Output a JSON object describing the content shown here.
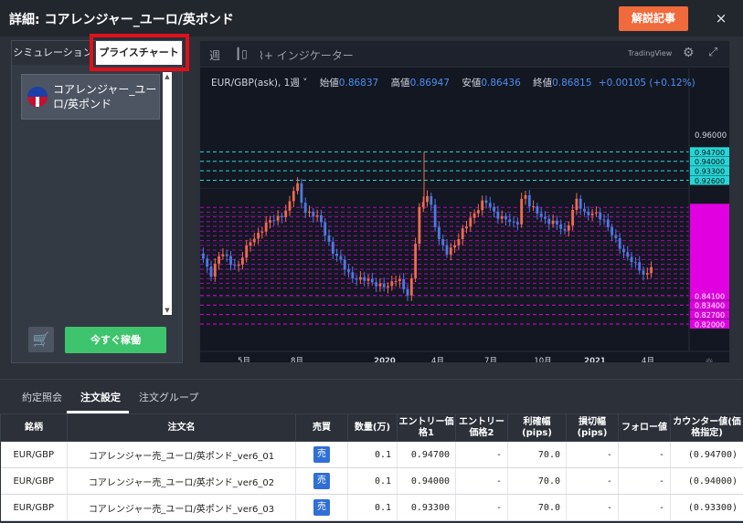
{
  "header": {
    "title": "詳細: コアレンジャー_ユーロ/英ポンド",
    "guide_button": "解説記事",
    "close": "×"
  },
  "left_panel": {
    "tabs": [
      "シミュレーション",
      "プライスチャート"
    ],
    "selected_item": "コアレンジャー_ユーロ/英ポンド",
    "run_button": "今すぐ稼働"
  },
  "chart": {
    "toolbar": {
      "period": "週",
      "indicator": "インジケーター",
      "brand": "TradingView"
    },
    "symbol": "EUR/GBP(ask), 1週",
    "ohlc": {
      "open_label": "始値",
      "open": "0.86837",
      "high_label": "高値",
      "high": "0.86947",
      "low_label": "安値",
      "low": "0.86436",
      "close_label": "終値",
      "close": "0.86815",
      "change": "+0.00105 (+0.12%)"
    },
    "price_top_label": "0.96000",
    "cyan_levels": [
      "0.94700",
      "0.94000",
      "0.93300",
      "0.92600"
    ],
    "magenta_levels": [
      "0.84100",
      "0.83400",
      "0.82700",
      "0.82000"
    ],
    "x_labels": [
      "5月",
      "8月",
      "2020",
      "4月",
      "7月",
      "10月",
      "2021",
      "4月"
    ],
    "colors": {
      "up": "#ef6b4f",
      "down": "#4a7be0",
      "cyan": "#26d6d6",
      "magenta": "#e000e0"
    }
  },
  "bottom": {
    "tabs": [
      "約定照会",
      "注文設定",
      "注文グループ"
    ],
    "table": {
      "headers": [
        "銘柄",
        "注文名",
        "売買",
        "数量(万)",
        "エントリー価格1",
        "エントリー価格2",
        "利確幅(pips)",
        "損切幅(pips)",
        "フォロー値",
        "カウンター値(価格指定)"
      ],
      "rows": [
        [
          "EUR/GBP",
          "コアレンジャー売_ユーロ/英ポンド_ver6_01",
          "売",
          "0.1",
          "0.94700",
          "-",
          "70.0",
          "-",
          "-",
          "(0.94700)"
        ],
        [
          "EUR/GBP",
          "コアレンジャー売_ユーロ/英ポンド_ver6_02",
          "売",
          "0.1",
          "0.94000",
          "-",
          "70.0",
          "-",
          "-",
          "(0.94000)"
        ],
        [
          "EUR/GBP",
          "コアレンジャー売_ユーロ/英ポンド_ver6_03",
          "売",
          "0.1",
          "0.93300",
          "-",
          "70.0",
          "-",
          "-",
          "(0.93300)"
        ]
      ]
    }
  }
}
